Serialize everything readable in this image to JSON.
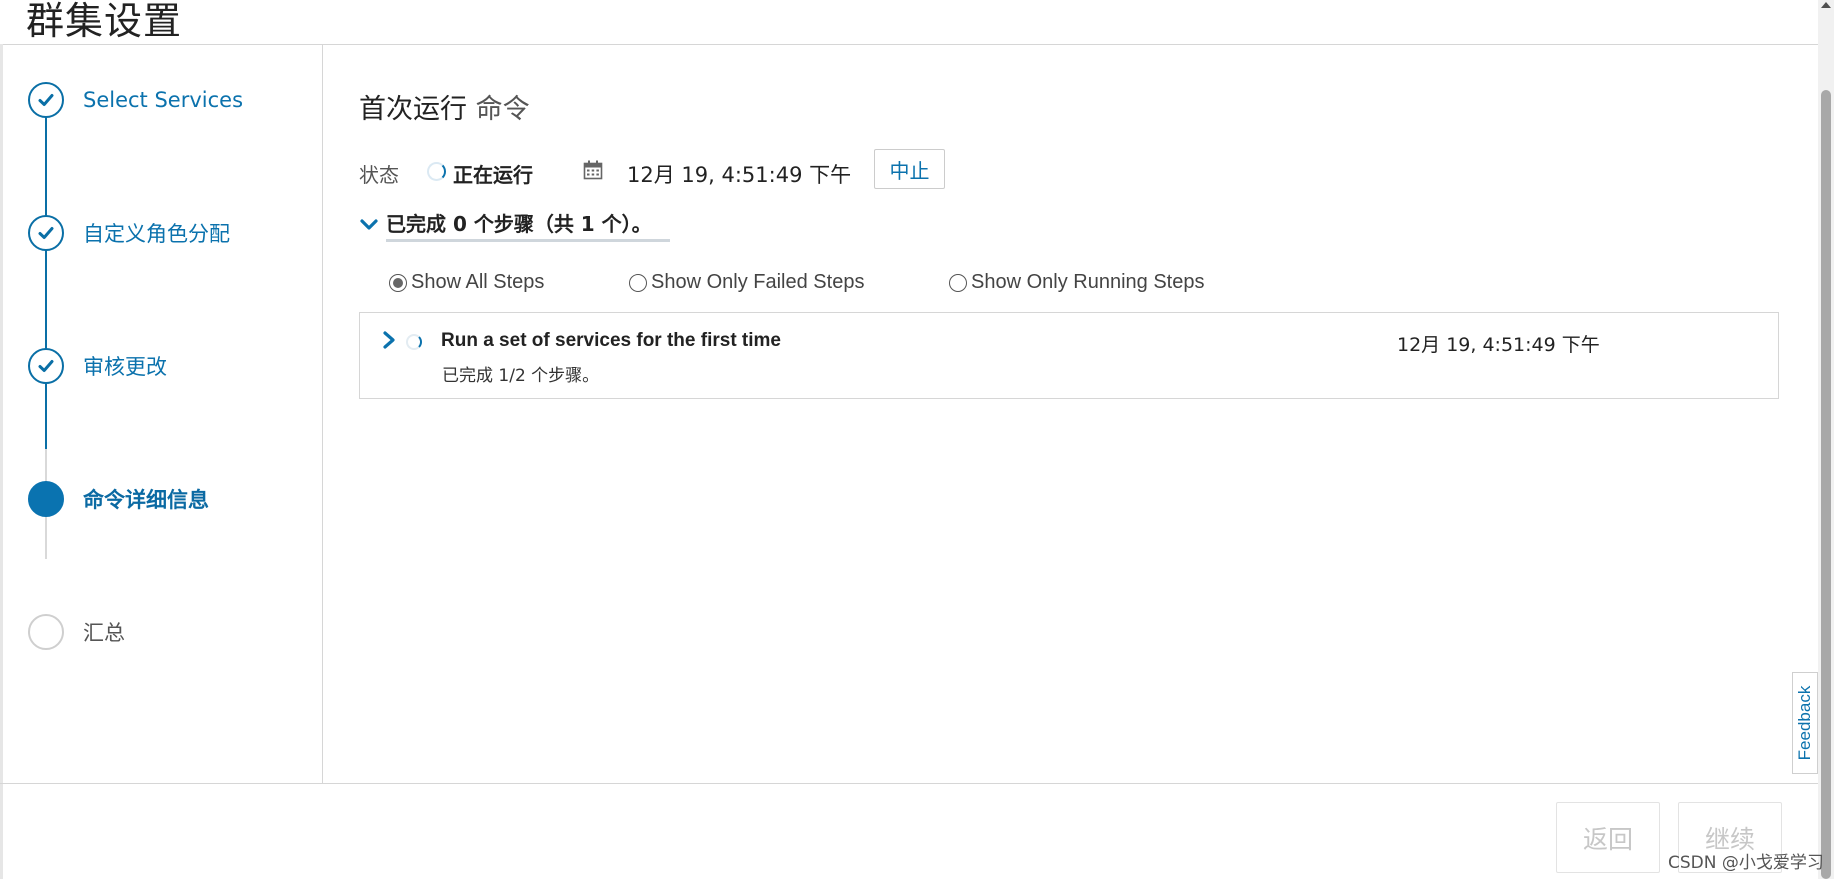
{
  "page": {
    "title": "群集设置"
  },
  "wizard": {
    "steps": [
      {
        "label": "Select Services",
        "state": "done"
      },
      {
        "label": "自定义角色分配",
        "state": "done"
      },
      {
        "label": "审核更改",
        "state": "done"
      },
      {
        "label": "命令详细信息",
        "state": "active"
      },
      {
        "label": "汇总",
        "state": "pending"
      }
    ]
  },
  "command": {
    "title": "首次运行",
    "title_suffix": "命令",
    "status_label": "状态",
    "status_value": "正在运行",
    "timestamp": "12月 19, 4:51:49 下午",
    "abort_label": "中止",
    "summary": "已完成 0 个步骤（共 1 个）。",
    "filters": [
      {
        "label": "Show All Steps",
        "checked": true
      },
      {
        "label": "Show Only Failed Steps",
        "checked": false
      },
      {
        "label": "Show Only Running Steps",
        "checked": false
      }
    ],
    "steps": [
      {
        "title": "Run a set of services for the first time",
        "timestamp": "12月 19, 4:51:49 下午",
        "progress_text": "已完成  1/2  个步骤。"
      }
    ]
  },
  "footer": {
    "back_label": "返回",
    "next_label": "继续"
  },
  "feedback_label": "Feedback",
  "watermark": "CSDN @小戈爱学习",
  "icons": {
    "done": "check-icon",
    "active": "filled-circle-icon",
    "calendar": "calendar-icon",
    "expand": "chevron-down-icon",
    "collapse": "chevron-right-icon"
  },
  "colors": {
    "accent": "#0b72ad",
    "border": "#d6d6d6",
    "disabled_text": "#c7c7c7"
  }
}
